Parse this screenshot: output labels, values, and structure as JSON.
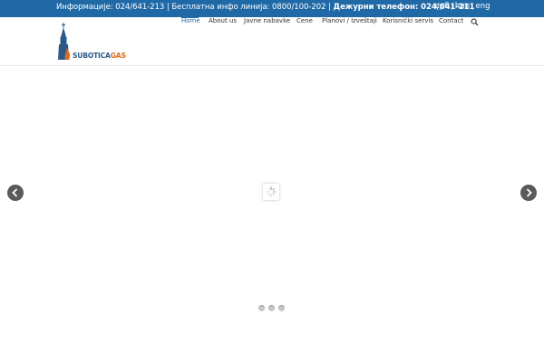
{
  "topbar": {
    "info_prefix": "Информације: 024/641-213 | Бесплатна инфо линија: 0800/100-202 | ",
    "duty_phone": "Дежурни телефон: 024/641-211",
    "languages": [
      "срб",
      "hun",
      "eng"
    ],
    "background": "#1f6aa6"
  },
  "logo": {
    "text_first": "SUBOTICA",
    "text_second": "GAS",
    "colors": {
      "primary": "#2a5a8a",
      "accent": "#e06a1a"
    }
  },
  "nav": {
    "items": [
      "Home",
      "About us",
      "Javne nabavke",
      "Cene",
      "Planovi / Izveštaji",
      "Korisnički servis",
      "Contact"
    ],
    "active_index": 0,
    "search_icon": "search-icon"
  },
  "slider": {
    "prev_icon": "chevron-left-icon",
    "next_icon": "chevron-right-icon",
    "loader_icon": "spinner-icon",
    "dot_count": 3
  }
}
